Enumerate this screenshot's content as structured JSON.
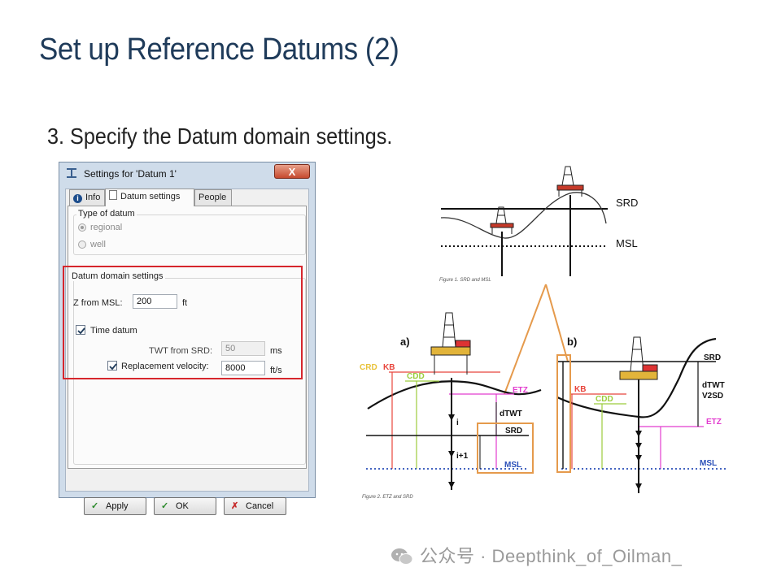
{
  "slide": {
    "title": "Set up Reference Datums (2)",
    "step": "3. Specify the Datum domain settings."
  },
  "dialog": {
    "title": "Settings for 'Datum 1'",
    "close_label": "X",
    "tabs": [
      {
        "label": "Info",
        "icon": "info-icon"
      },
      {
        "label": "Datum settings",
        "icon": "document-icon",
        "active": true
      },
      {
        "label": "People"
      }
    ],
    "type_of_datum": {
      "label": "Type of datum",
      "options": [
        {
          "label": "regional",
          "selected": true
        },
        {
          "label": "well",
          "selected": false
        }
      ]
    },
    "datum_domain": {
      "label": "Datum domain settings",
      "z_from_msl_label": "Z from MSL:",
      "z_from_msl_value": "200",
      "z_from_msl_unit": "ft",
      "time_datum_label": "Time datum",
      "time_datum_checked": true,
      "twt_label": "TWT from SRD:",
      "twt_value": "50",
      "twt_unit": "ms",
      "replacement_velocity_label": "Replacement velocity:",
      "replacement_velocity_checked": true,
      "replacement_velocity_value": "8000",
      "replacement_velocity_unit": "ft/s"
    },
    "buttons": {
      "apply": "Apply",
      "ok": "OK",
      "cancel": "Cancel"
    }
  },
  "figure1": {
    "srd": "SRD",
    "msl": "MSL",
    "caption": "Figure 1. SRD and MSL"
  },
  "figure2": {
    "a_label": "a)",
    "b_label": "b)",
    "crd": "CRD",
    "kb": "KB",
    "cdd": "CDD",
    "etz": "ETZ",
    "dtwt": "dTWT",
    "srd": "SRD",
    "msl": "MSL",
    "i": "i",
    "i_plus_1": "i+1",
    "v2sd": "V2SD",
    "caption": "Figure 2. ETZ and SRD"
  },
  "watermark": "公众号 · Deepthink_of_Oilman_",
  "colors": {
    "title": "#1f3b5a",
    "highlight_red": "#d6262c",
    "highlight_orange": "#e59a4c",
    "crd": "#e8c23a",
    "kb": "#e8453c",
    "cdd": "#9ccc3c",
    "etz": "#e23ccf",
    "msl": "#2a4fb8"
  }
}
